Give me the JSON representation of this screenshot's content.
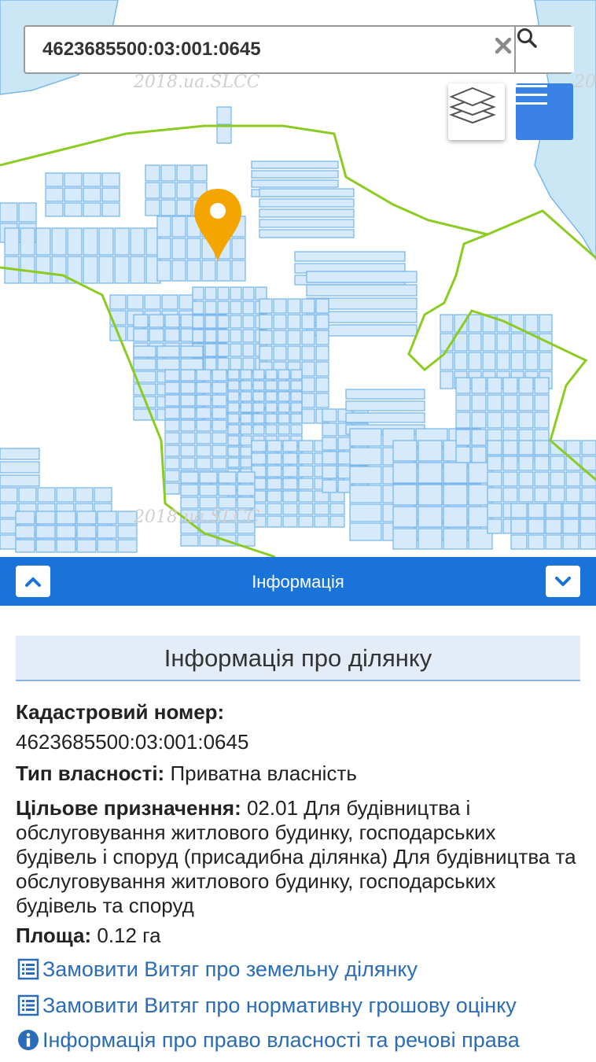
{
  "search": {
    "value": "4623685500:03:001:0645",
    "placeholder": ""
  },
  "map": {
    "watermark": "2018.ua.SLCC",
    "colors": {
      "parcel_fill": "#d6eafc",
      "parcel_stroke": "#7ab8ec",
      "boundary": "#8ccc22",
      "marker": "#f4a500",
      "water": "#cbe7f6"
    }
  },
  "panel": {
    "title": "Інформація"
  },
  "info": {
    "heading": "Інформація про ділянку",
    "cadastral_label": "Кадастровий номер:",
    "cadastral_value": "4623685500:03:001:0645",
    "ownership_label": "Тип власності:",
    "ownership_value": "Приватна власність",
    "purpose_label": "Цільове призначення:",
    "purpose_value": "02.01 Для будівництва і обслуговування житлового будинку, господарських будівель і споруд (присадибна ділянка) Для будівництва та обслуговування житлового будинку, господарських будівель та споруд",
    "area_label": "Площа:",
    "area_value": "0.12 га"
  },
  "links": [
    {
      "label": "Замовити Витяг про земельну ділянку",
      "icon": "list-icon"
    },
    {
      "label": "Замовити Витяг про нормативну грошову оцінку",
      "icon": "list-icon"
    },
    {
      "label": "Інформація про право власності та речові права",
      "icon": "info-icon"
    }
  ],
  "colors": {
    "header": "#1a73d9",
    "menu_button": "#3b82e6",
    "link": "#2a6cb8",
    "heading_bg": "#e4ecf8"
  }
}
